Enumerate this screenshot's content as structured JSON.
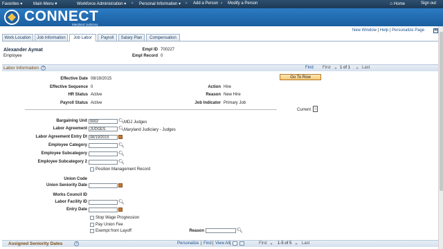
{
  "topnav": {
    "items": [
      "Favorites",
      "Main Menu",
      "Workforce Administration",
      "Personal Information",
      "Add a Person",
      "Modify a Person"
    ],
    "home": "Home",
    "signout": "Sign out"
  },
  "banner": {
    "brand": "CONNECT",
    "subtitle": "Maryland Judiciary"
  },
  "page_links": [
    "New Window",
    "Help",
    "Personalize Page"
  ],
  "tabs": [
    "Work Location",
    "Job Information",
    "Job Labor",
    "Payroll",
    "Salary Plan",
    "Compensation"
  ],
  "active_tab": "Job Labor",
  "employee": {
    "name": "Alexander Aymat",
    "type": "Employee",
    "empl_id_label": "Empl ID",
    "empl_id": "700227",
    "empl_record_label": "Empl Record",
    "empl_record": "0"
  },
  "labor_section": {
    "title": "Labor Information",
    "find": "Find",
    "first": "First",
    "pager": "1 of 1",
    "last": "Last",
    "goto_row": "Go To Row"
  },
  "summary": {
    "effective_date_label": "Effective Date",
    "effective_date": "08/19/2015",
    "effective_sequence_label": "Effective Sequence",
    "effective_sequence": "0",
    "hr_status_label": "HR Status",
    "hr_status": "Active",
    "payroll_status_label": "Payroll Status",
    "payroll_status": "Active",
    "action_label": "Action",
    "action": "Hire",
    "reason_label": "Reason",
    "reason": "New Hire",
    "job_indicator_label": "Job Indicator",
    "job_indicator": "Primary Job",
    "current_label": "Current"
  },
  "form": {
    "bargaining_unit_label": "Bargaining Unit",
    "bargaining_unit": "0002",
    "bargaining_unit_desc": "MDJ Judges",
    "labor_agreement_label": "Labor Agreement",
    "labor_agreement": "JUDGES",
    "labor_agreement_desc": "Maryland Judiciary - Judges",
    "labor_agreement_entry_label": "Labor Agreement Entry Dt",
    "labor_agreement_entry": "08/19/2015",
    "employee_category_label": "Employee Category",
    "employee_subcategory_label": "Employee Subcategory",
    "employee_subcategory2_label": "Employee Subcategory 2",
    "position_mgmt_label": "Position Management Record",
    "union_code_label": "Union Code",
    "union_seniority_label": "Union Seniority Date",
    "works_council_label": "Works Council ID",
    "labor_facility_label": "Labor Facility ID",
    "entry_date_label": "Entry Date",
    "stop_wage_label": "Stop Wage Progression",
    "pay_union_fee_label": "Pay Union Fee",
    "exempt_layoff_label": "Exempt from Layoff",
    "reason_label": "Reason"
  },
  "seniority_section": {
    "title": "Assigned Seniority Dates",
    "personalize": "Personalize",
    "find": "Find",
    "view_all": "View All",
    "first": "First",
    "pager": "1-5 of 5",
    "last": "Last"
  }
}
